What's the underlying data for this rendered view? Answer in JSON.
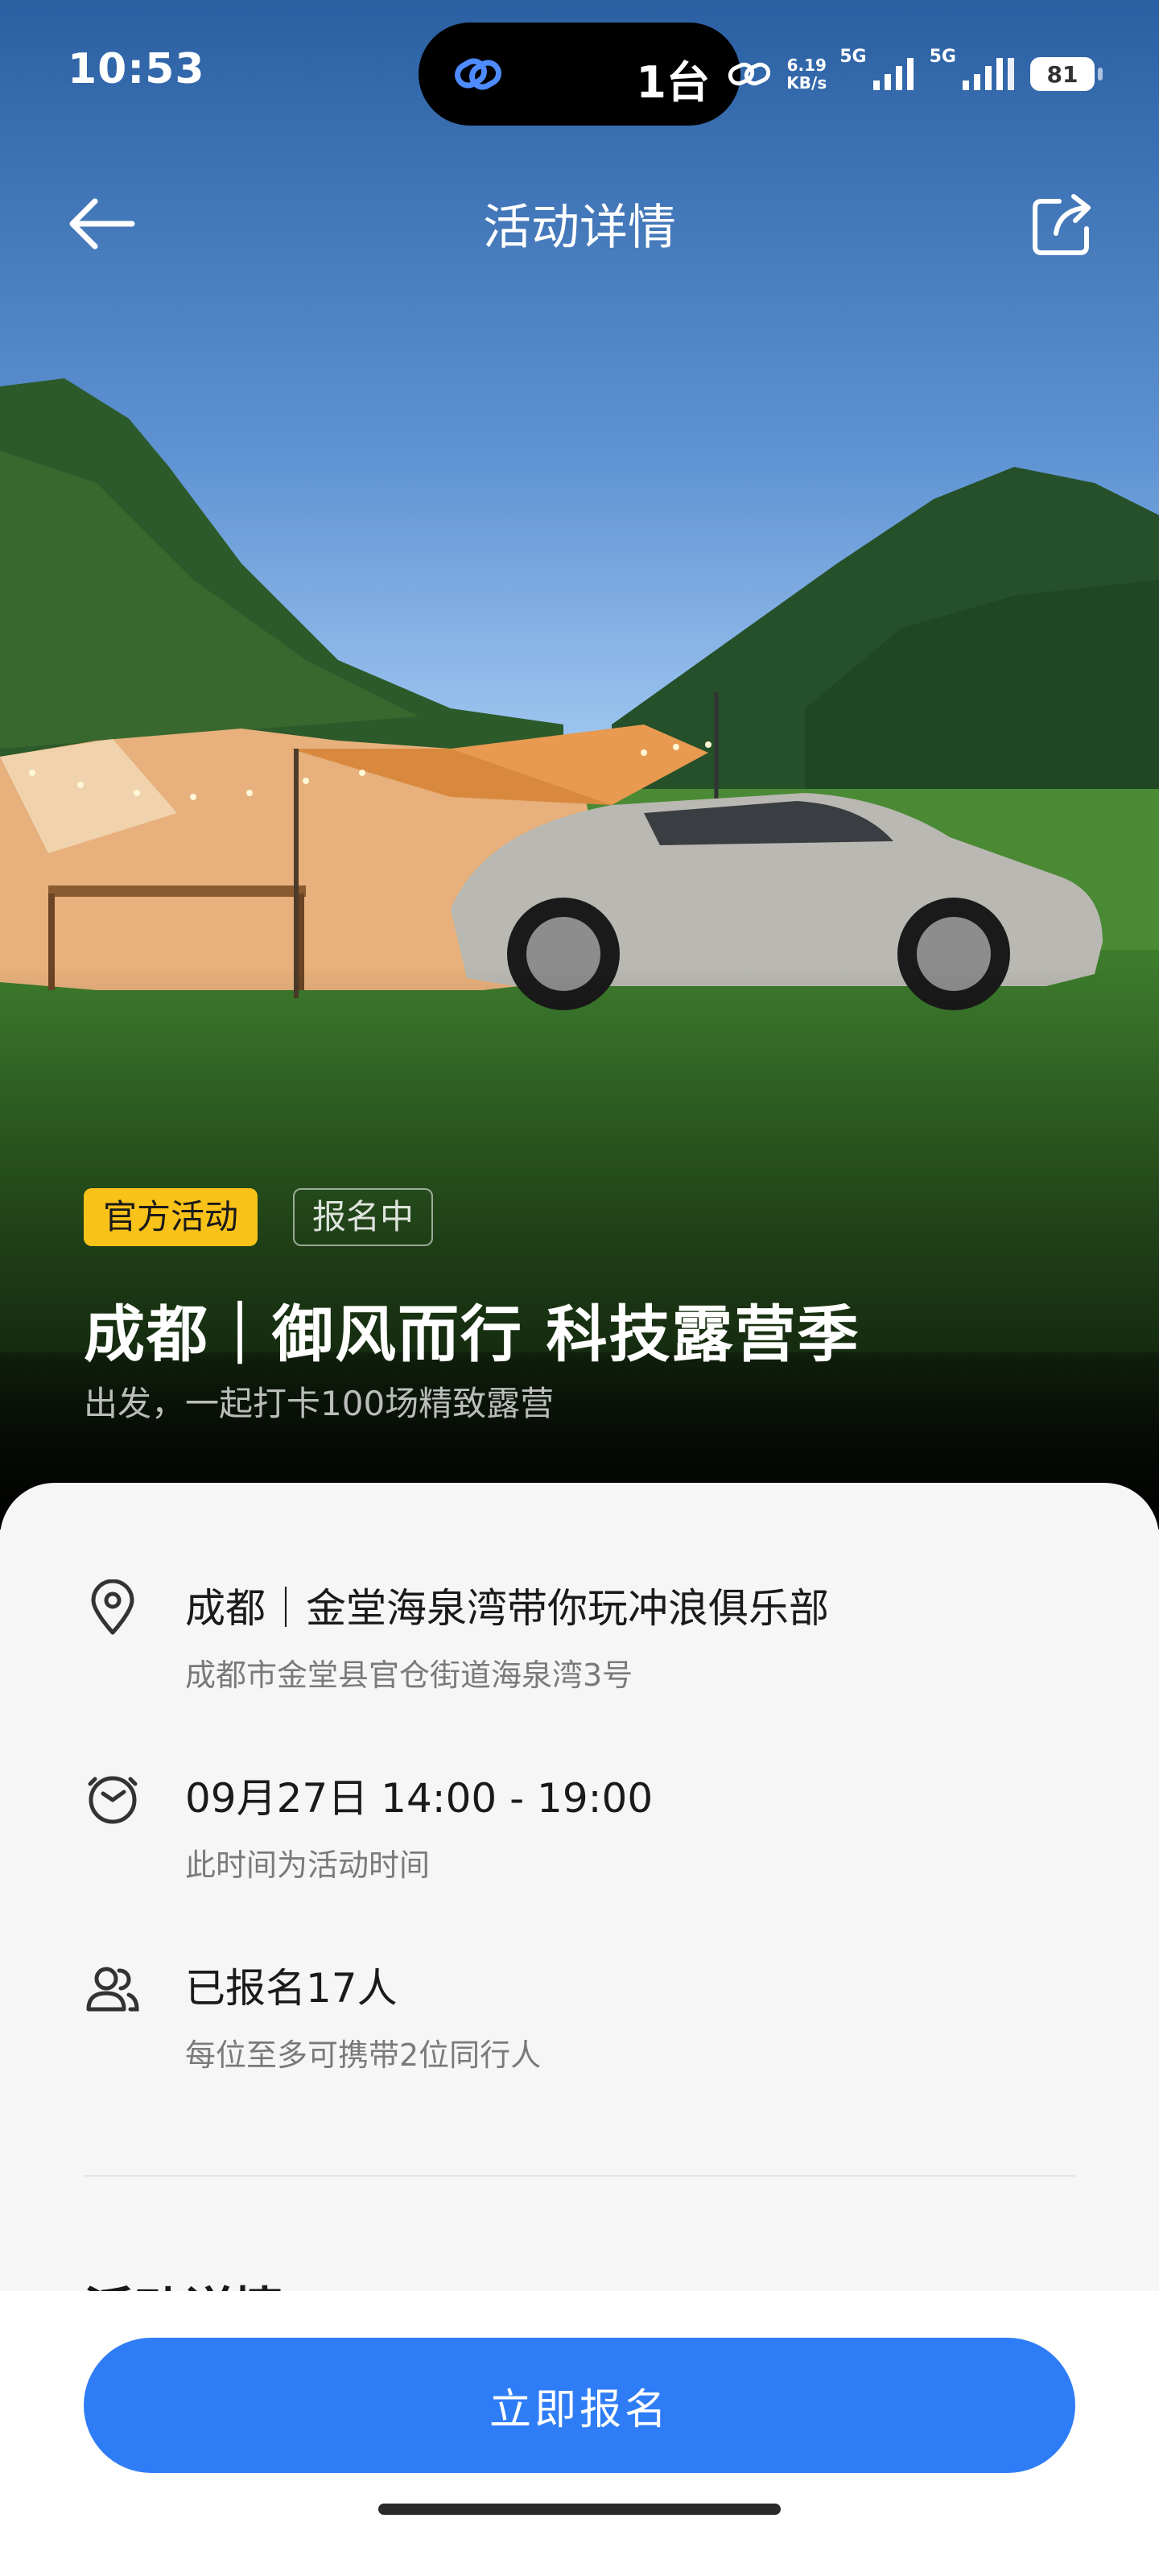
{
  "status_bar": {
    "time": "10:53",
    "island_text": "1台",
    "net_speed_value": "6.19",
    "net_speed_unit": "KB/s",
    "signal_1_label": "5G",
    "signal_2_label": "5G",
    "battery": "81"
  },
  "nav": {
    "title": "活动详情"
  },
  "hero": {
    "tag_official": "官方活动",
    "tag_status": "报名中",
    "title": "成都｜御风而行 科技露营季",
    "subtitle": "出发，一起打卡100场精致露营"
  },
  "info": {
    "location": {
      "icon": "location-pin-icon",
      "main": "成都｜金堂海泉湾带你玩冲浪俱乐部",
      "sub": "成都市金堂县官仓街道海泉湾3号"
    },
    "time": {
      "icon": "clock-icon",
      "main": "09月27日 14:00 - 19:00",
      "sub": "此时间为活动时间"
    },
    "participants": {
      "icon": "people-icon",
      "main": "已报名17人",
      "sub": "每位至多可携带2位同行人"
    }
  },
  "section": {
    "heading": "活动详情"
  },
  "actions": {
    "signup_label": "立即报名"
  },
  "colors": {
    "primary": "#2f7df6",
    "official_tag": "#f9c219"
  }
}
